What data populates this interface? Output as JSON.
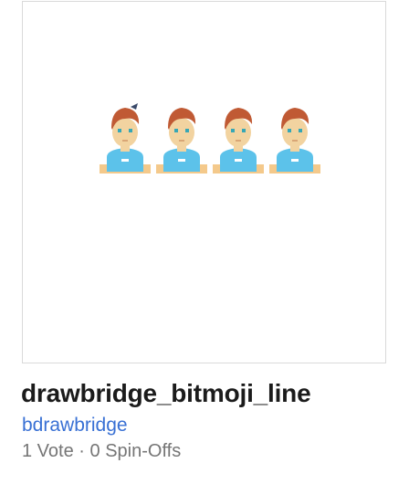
{
  "project": {
    "title": "drawbridge_bitmoji_line",
    "author": "bdrawbridge",
    "votes_text": "1 Vote",
    "separator": "·",
    "spinoffs_text": "0 Spin-Offs",
    "thumbnail": {
      "figure_count": 4,
      "icon": "boy-avatar-icon",
      "colors": {
        "hair": "#c05a34",
        "skin": "#f2d3a0",
        "shirt": "#5cc2ea",
        "eyes": "#37a7b5",
        "ground": "#f4c98b"
      }
    }
  }
}
